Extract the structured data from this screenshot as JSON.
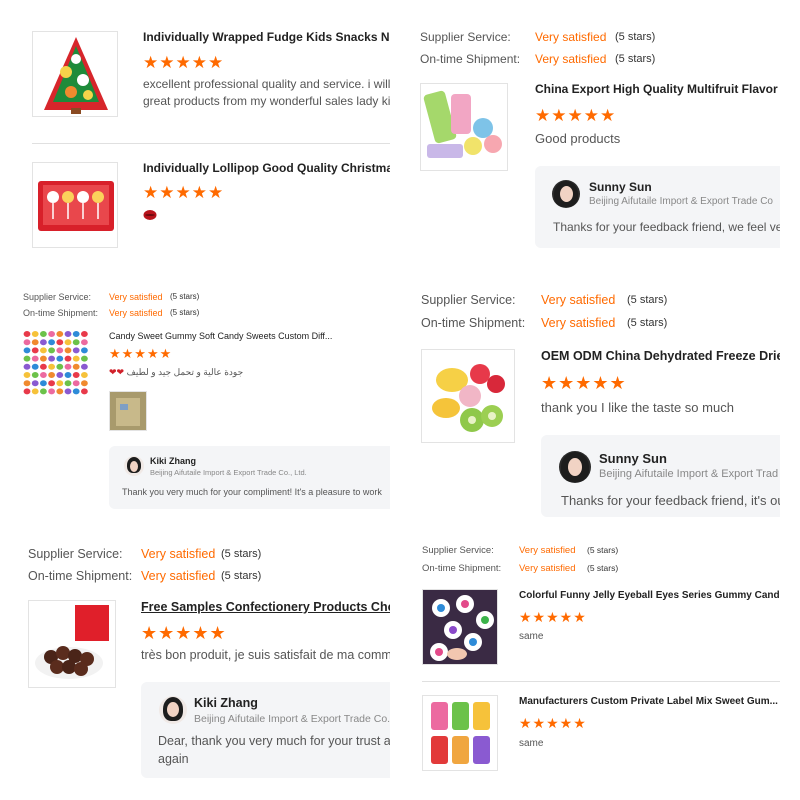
{
  "p1": {
    "items": [
      {
        "title": "Individually Wrapped Fudge Kids Snacks New T",
        "stars": "★★★★★",
        "comment1": "excellent professional quality and service. i will",
        "comment2": "great products from my wonderful sales lady ki"
      },
      {
        "title": "Individually Lollipop Good Quality Christmas Co",
        "stars": "★★★★★",
        "comment_icon": "lips-emoji-icon"
      }
    ]
  },
  "p2": {
    "supplier_label": "Supplier Service:",
    "supplier_value": "Very satisfied",
    "supplier_count": "(5 stars)",
    "shipment_label": "On-time Shipment:",
    "shipment_value": "Very satisfied",
    "shipment_count": "(5 stars)",
    "title": "China Export High Quality Multifruit Flavor Sc",
    "stars": "★★★★★",
    "comment": "Good products",
    "reply": {
      "name": "Sunny Sun",
      "company": "Beijing Aifutaile Import & Export Trade Co",
      "text": "Thanks for your feedback friend, we feel ve"
    }
  },
  "p3": {
    "supplier_label": "Supplier Service:",
    "supplier_value": "Very satisfied",
    "supplier_count": "(5 stars)",
    "shipment_label": "On-time Shipment:",
    "shipment_value": "Very satisfied",
    "shipment_count": "(5 stars)",
    "title": "Candy Sweet Gummy Soft Candy Sweets Custom Diff...",
    "stars": "★★★★★",
    "comment": "جودة عالية و تحمل جيد و لطيف",
    "reply": {
      "name": "Kiki Zhang",
      "company": "Beijing Aifutaile Import & Export Trade Co., Ltd.",
      "text": "Thank you very much for your compliment! It's a pleasure to work"
    }
  },
  "p4": {
    "supplier_label": "Supplier Service:",
    "supplier_value": "Very satisfied",
    "supplier_count": "(5 stars)",
    "shipment_label": "On-time Shipment:",
    "shipment_value": "Very satisfied",
    "shipment_count": "(5 stars)",
    "title": "OEM ODM China Dehydrated Freeze Driec",
    "stars": "★★★★★",
    "comment": "thank you I like the taste so much",
    "reply": {
      "name": "Sunny Sun",
      "company": "Beijing Aifutaile Import & Export Trad",
      "text": "Thanks for your feedback friend, it's ou"
    }
  },
  "p5": {
    "supplier_label": "Supplier Service:",
    "supplier_value": "Very satisfied",
    "supplier_count": "(5 stars)",
    "shipment_label": "On-time Shipment:",
    "shipment_value": "Very satisfied",
    "shipment_count": "(5 stars)",
    "title": "Free Samples Confectionery Products Chocola",
    "stars": "★★★★★",
    "comment": "très bon produit, je suis satisfait de ma comma",
    "reply": {
      "name": "Kiki Zhang",
      "company": "Beijing Aifutaile Import & Export Trade Co.,",
      "text1": "Dear, thank you very much for your trust and",
      "text2": "again"
    }
  },
  "p6": {
    "supplier_label": "Supplier Service:",
    "supplier_value": "Very satisfied",
    "supplier_count": "(5 stars)",
    "shipment_label": "On-time Shipment:",
    "shipment_value": "Very satisfied",
    "shipment_count": "(5 stars)",
    "items": [
      {
        "title": "Colorful Funny Jelly Eyeball Eyes Series Gummy Cand...",
        "stars": "★★★★★",
        "comment": "same"
      },
      {
        "title": "Manufacturers Custom Private Label Mix Sweet Gum...",
        "stars": "★★★★★",
        "comment": "same"
      }
    ]
  },
  "colors": {
    "accent": "#ff6a00",
    "reply_bg": "#f4f5f7"
  }
}
